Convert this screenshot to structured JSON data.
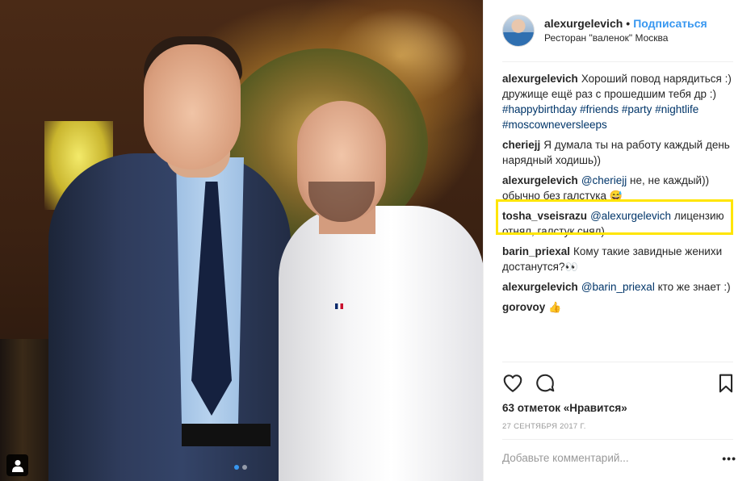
{
  "post": {
    "username": "alexurgelevich",
    "separator": "•",
    "follow_label": "Подписаться",
    "location": "Ресторан \"валенок\" Москва"
  },
  "comments": [
    {
      "user": "alexurgelevich",
      "parts": [
        {
          "t": "Хороший повод нарядиться :) дружище ещё раз с прошедшим тебя др :) "
        },
        {
          "t": "#happybirthday",
          "tag": true
        },
        {
          "t": " "
        },
        {
          "t": "#friends",
          "tag": true
        },
        {
          "t": " "
        },
        {
          "t": "#party",
          "tag": true
        },
        {
          "t": " "
        },
        {
          "t": "#nightlife",
          "tag": true
        },
        {
          "t": " "
        },
        {
          "t": "#moscowneversleeps",
          "tag": true
        }
      ]
    },
    {
      "user": "cheriejj",
      "parts": [
        {
          "t": "Я думала ты на работу каждый день нарядный ходишь))"
        }
      ]
    },
    {
      "user": "alexurgelevich",
      "parts": [
        {
          "t": "@cheriejj",
          "tag": true
        },
        {
          "t": " не, не каждый)) обычно без галстука "
        },
        {
          "t": "😅",
          "emoji": true
        }
      ]
    },
    {
      "user": "tosha_vseisrazu",
      "parts": [
        {
          "t": "@alexurgelevich",
          "tag": true
        },
        {
          "t": " лицензию отнял, галстук снял)"
        }
      ]
    },
    {
      "user": "barin_priexal",
      "parts": [
        {
          "t": "Кому такие завидные женихи достанутся?"
        },
        {
          "t": "👀",
          "emoji": true
        }
      ]
    },
    {
      "user": "alexurgelevich",
      "parts": [
        {
          "t": "@barin_priexal",
          "tag": true
        },
        {
          "t": " кто же знает :)"
        }
      ]
    },
    {
      "user": "gorovoy",
      "parts": [
        {
          "t": "👍",
          "emoji": true
        }
      ]
    }
  ],
  "likes_text": "63 отметок «Нравится»",
  "date_text": "27 сентября 2017 г.",
  "comment_placeholder": "Добавьте комментарий...",
  "more_label": "•••",
  "icons": {
    "like": "heart-outline-icon",
    "comment": "speech-bubble-icon",
    "save": "bookmark-icon",
    "photo_tag": "user-icon"
  },
  "colors": {
    "link": "#3897f0",
    "hashtag": "#003569",
    "highlight": "#ffe500",
    "muted": "#999999"
  },
  "carousel": {
    "count": 2,
    "active": 1
  }
}
